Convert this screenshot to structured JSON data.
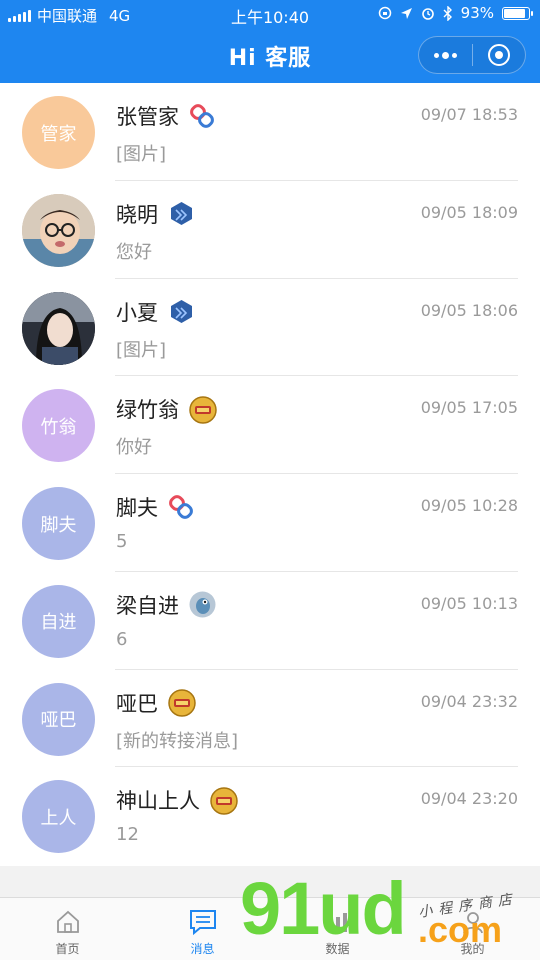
{
  "status_bar": {
    "carrier": "中国联通",
    "network": "4G",
    "time": "上午10:40",
    "battery": "93%",
    "battery_level": 0.93
  },
  "nav": {
    "title": "Hi 客服",
    "more_icon": "more-dots-icon",
    "close_icon": "target-circle-icon"
  },
  "conversations": [
    {
      "avatar_text": "管家",
      "avatar_color": "#f9c99a",
      "avatar_type": "text",
      "name": "张管家",
      "badge": "chain-link-badge",
      "time": "09/07 18:53",
      "preview": "[图片]"
    },
    {
      "avatar_text": "",
      "avatar_color": "#c9b9a8",
      "avatar_type": "photo",
      "name": "晓明",
      "badge": "hexagon-badge",
      "time": "09/05 18:09",
      "preview": "您好"
    },
    {
      "avatar_text": "",
      "avatar_color": "#2f3440",
      "avatar_type": "photo",
      "name": "小夏",
      "badge": "hexagon-badge",
      "time": "09/05 18:06",
      "preview": "[图片]"
    },
    {
      "avatar_text": "竹翁",
      "avatar_color": "#cfb3f0",
      "avatar_type": "text",
      "name": "绿竹翁",
      "badge": "gold-emblem-badge",
      "time": "09/05 17:05",
      "preview": "你好"
    },
    {
      "avatar_text": "脚夫",
      "avatar_color": "#aab6e8",
      "avatar_type": "text",
      "name": "脚夫",
      "badge": "chain-link-badge",
      "time": "09/05 10:28",
      "preview": "5"
    },
    {
      "avatar_text": "自进",
      "avatar_color": "#aab6e8",
      "avatar_type": "text",
      "name": "梁自进",
      "badge": "bird-avatar-badge",
      "time": "09/05 10:13",
      "preview": "6"
    },
    {
      "avatar_text": "哑巴",
      "avatar_color": "#aab6e8",
      "avatar_type": "text",
      "name": "哑巴",
      "badge": "gold-emblem-badge",
      "time": "09/04 23:32",
      "preview": "[新的转接消息]"
    },
    {
      "avatar_text": "上人",
      "avatar_color": "#aab6e8",
      "avatar_type": "text",
      "name": "神山上人",
      "badge": "gold-emblem-badge",
      "time": "09/04 23:20",
      "preview": "12"
    }
  ],
  "tabs": [
    {
      "label": "首页",
      "icon": "home-icon",
      "active": false
    },
    {
      "label": "消息",
      "icon": "message-icon",
      "active": true
    },
    {
      "label": "数据",
      "icon": "data-icon",
      "active": false
    },
    {
      "label": "我的",
      "icon": "profile-icon",
      "active": false
    }
  ],
  "watermark": {
    "logo": "91ud",
    "domain": ".com",
    "tagline": "小程序商店"
  },
  "colors": {
    "brand": "#1e86f0",
    "active_tab": "#1e86f0",
    "watermark_green": "#6bd63e",
    "watermark_orange": "#f6a11a"
  }
}
